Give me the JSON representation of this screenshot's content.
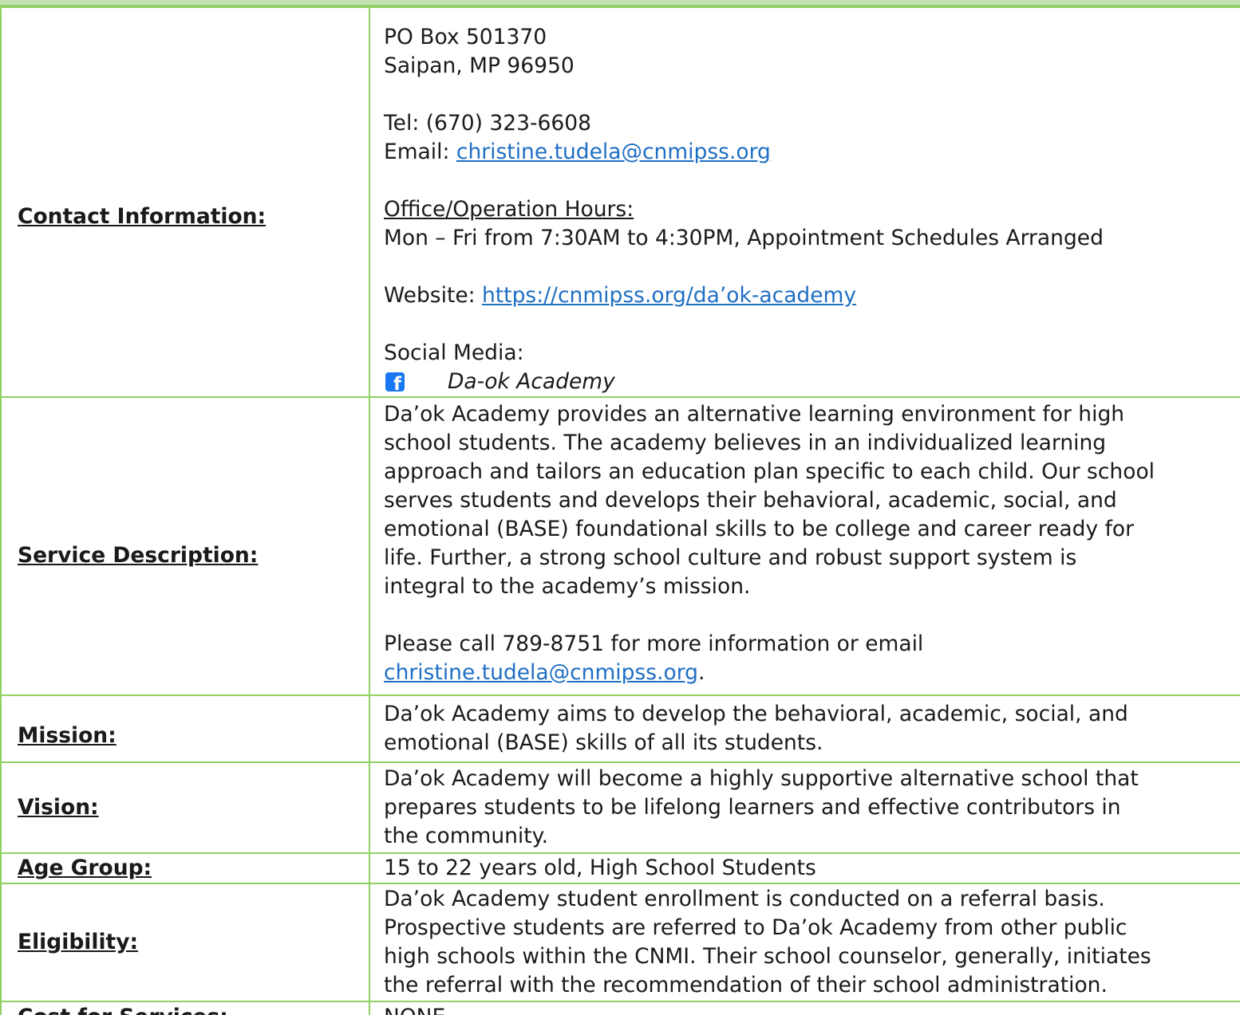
{
  "contact": {
    "label": "Contact Information:",
    "po_box": "PO Box 501370",
    "city": "Saipan, MP 96950",
    "tel": "Tel: (670) 323-6608",
    "email_prefix": "Email: ",
    "email": "christine.tudela@cnmipss.org",
    "hours_label": "Office/Operation Hours:",
    "hours": "Mon – Fri from 7:30AM to 4:30PM, Appointment Schedules Arranged",
    "website_prefix": "Website: ",
    "website": "https://cnmipss.org/da’ok-academy",
    "social_label": "Social Media:",
    "social_icon": "facebook-icon",
    "social_name": "Da-ok Academy"
  },
  "service": {
    "label": "Service Description:",
    "lines": [
      "Da’ok Academy provides an alternative learning environment for high",
      "school students. The academy believes in an individualized learning",
      "approach and tailors an education plan specific to each child. Our school",
      "serves students and develops their behavioral, academic, social, and",
      "emotional (BASE) foundational skills to be college and career ready for",
      "life. Further, a strong school culture and robust support system is",
      "integral to the academy’s mission."
    ],
    "call_text": "Please call 789-8751 for more information or email",
    "email": "christine.tudela@cnmipss.org",
    "email_suffix": "."
  },
  "mission": {
    "label": "Mission:",
    "lines": [
      "Da’ok Academy aims to develop the behavioral, academic, social, and",
      "emotional (BASE) skills of all its students."
    ]
  },
  "vision": {
    "label": "Vision:",
    "lines": [
      "Da’ok Academy will become a highly supportive alternative school that",
      "prepares students to be lifelong learners and effective contributors in",
      "the community."
    ]
  },
  "age_group": {
    "label": "Age Group:",
    "value": "15 to 22 years old, High School Students"
  },
  "eligibility": {
    "label": "Eligibility:",
    "lines": [
      "Da’ok Academy student enrollment is conducted on a referral basis.",
      "Prospective students are referred to Da’ok Academy from other public",
      "high schools within the CNMI. Their school counselor, generally, initiates",
      "the referral with the recommendation of their school administration."
    ]
  },
  "cost": {
    "label": "Cost for Services:",
    "value": "NONE"
  },
  "colors": {
    "border": "#8fd163",
    "header_band": "#c5e0b3",
    "link": "#1f6fc4",
    "facebook": "#1877f2"
  }
}
